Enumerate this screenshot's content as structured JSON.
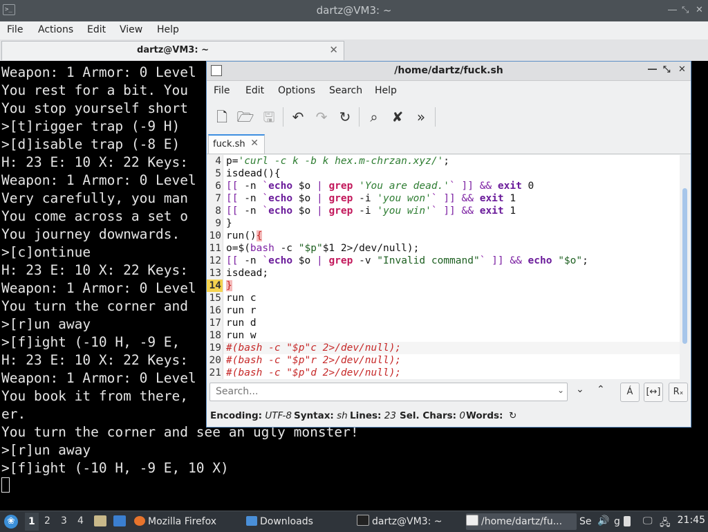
{
  "terminal": {
    "window_title": "dartz@VM3: ~",
    "menu": [
      "File",
      "Actions",
      "Edit",
      "View",
      "Help"
    ],
    "tab_title": "dartz@VM3: ~",
    "lines": [
      "Weapon: 1 Armor: 0 Level",
      "You rest for a bit. You",
      "You stop yourself short",
      ">[t]rigger trap (-9 H)",
      ">[d]isable trap (-8 E)",
      "H: 23 E: 10 X: 22 Keys:",
      "Weapon: 1 Armor: 0 Level",
      "Very carefully, you man",
      "You come across a set o",
      "You journey downwards.",
      ">[c]ontinue",
      "H: 23 E: 10 X: 22 Keys:",
      "Weapon: 1 Armor: 0 Level",
      "You turn the corner and",
      ">[r]un away",
      ">[f]ight (-10 H, -9 E,",
      "H: 23 E: 10 X: 22 Keys:",
      "Weapon: 1 Armor: 0 Level",
      "You book it from there,",
      "er.",
      "You turn the corner and see an ugly monster!",
      ">[r]un away",
      ">[f]ight (-10 H, -9 E, 10 X)"
    ]
  },
  "editor": {
    "window_title": "/home/dartz/fuck.sh",
    "menu": [
      "File",
      "Edit",
      "Options",
      "Search",
      "Help"
    ],
    "tab_label": "fuck.sh",
    "current_line": "14",
    "line_numbers": [
      "4",
      "5",
      "6",
      "7",
      "8",
      "9",
      "10",
      "11",
      "12",
      "13",
      "14",
      "15",
      "16",
      "17",
      "18",
      "19",
      "20",
      "21"
    ],
    "search_placeholder": "Search...",
    "status": {
      "encoding_label": "Encoding:",
      "encoding_value": "UTF-8",
      "syntax_label": "Syntax:",
      "syntax_value": "sh",
      "lines_label": "Lines:",
      "lines_value": "23",
      "sel_label": "Sel. Chars:",
      "sel_value": "0",
      "words_label": "Words:"
    }
  },
  "code": {
    "l4": {
      "a": "p=",
      "b": "'curl -c k -b k hex.m-chrzan.xyz/'",
      "c": ";"
    },
    "l5": {
      "a": "isdead(){"
    },
    "l6": {
      "a": "[[",
      "b": " -n ",
      "c": "`",
      "d": "echo",
      "e": " $o ",
      "f": "|",
      "g": " ",
      "h": "grep",
      "i": " ",
      "j": "'You are dead.'",
      "k": "`",
      "l": " ]] ",
      "m": "&&",
      "n": " ",
      "o": "exit",
      "p": " 0"
    },
    "l7": {
      "a": "[[",
      "b": " -n ",
      "c": "`",
      "d": "echo",
      "e": " $o ",
      "f": "|",
      "g": " ",
      "h": "grep",
      "i": " -i ",
      "j": "'you won'",
      "k": "`",
      "l": " ]] ",
      "m": "&&",
      "n": " ",
      "o": "exit",
      "p": " 1"
    },
    "l8": {
      "a": "[[",
      "b": " -n ",
      "c": "`",
      "d": "echo",
      "e": " $o ",
      "f": "|",
      "g": " ",
      "h": "grep",
      "i": " -i ",
      "j": "'you win'",
      "k": "`",
      "l": " ]] ",
      "m": "&&",
      "n": " ",
      "o": "exit",
      "p": " 1"
    },
    "l9": {
      "a": "}"
    },
    "l10": {
      "a": "run()",
      "b": "{"
    },
    "l11": {
      "a": "o=$(",
      "b": "bash",
      "c": " -c ",
      "d": "\"$p\"",
      "e": "$1 2>/dev/null);"
    },
    "l12": {
      "a": "[[",
      "b": " -n ",
      "c": "`",
      "d": "echo",
      "e": " $o ",
      "f": "|",
      "g": " ",
      "h": "grep",
      "i": " -v ",
      "j": "\"Invalid command\"",
      "k": "`",
      "l": " ]] ",
      "m": "&&",
      "n": " ",
      "o": "echo",
      "p": " ",
      "q": "\"$o\"",
      "r": ";"
    },
    "l13": {
      "a": "isdead;"
    },
    "l14": {
      "a": "}"
    },
    "l15": {
      "a": "run c"
    },
    "l16": {
      "a": "run r"
    },
    "l17": {
      "a": "run d"
    },
    "l18": {
      "a": "run w"
    },
    "l19": {
      "a": "#(bash -c \"$p\"c 2>/dev/null);"
    },
    "l20": {
      "a": "#(bash -c \"$p\"r 2>/dev/null);"
    },
    "l21": {
      "a": "#(bash -c \"$p\"d 2>/dev/null);"
    }
  },
  "taskbar": {
    "workspaces": [
      "1",
      "2",
      "3",
      "4"
    ],
    "tasks": [
      "Mozilla Firefox",
      "Downloads",
      "dartz@VM3: ~",
      "/home/dartz/fu...",
      "Se",
      "g"
    ],
    "clock": "21:45"
  }
}
